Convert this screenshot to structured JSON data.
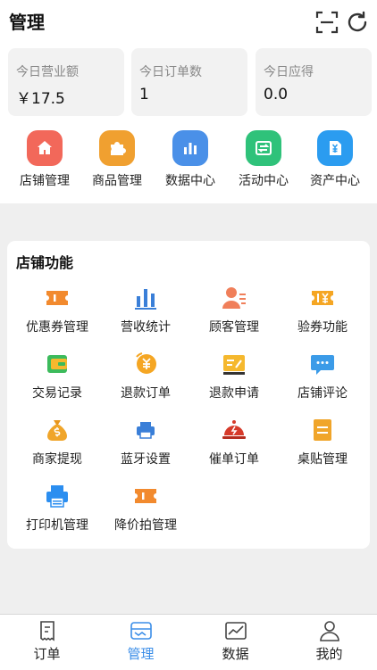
{
  "header": {
    "title": "管理",
    "scan_icon": "scan-icon",
    "refresh_icon": "refresh-icon"
  },
  "stats": [
    {
      "label": "今日营业额",
      "value": "￥17.5"
    },
    {
      "label": "今日订单数",
      "value": "1"
    },
    {
      "label": "今日应得",
      "value": "0.0"
    }
  ],
  "quick_menu": [
    {
      "label": "店铺管理",
      "icon": "store-icon",
      "color": "#f2685a"
    },
    {
      "label": "商品管理",
      "icon": "puzzle-icon",
      "color": "#f0a030"
    },
    {
      "label": "数据中心",
      "icon": "bar-chart-icon",
      "color": "#4a90e8"
    },
    {
      "label": "活动中心",
      "icon": "exchange-icon",
      "color": "#2fc27a"
    },
    {
      "label": "资产中心",
      "icon": "wallet-icon",
      "color": "#2b9cf0"
    }
  ],
  "store_functions": {
    "title": "店铺功能",
    "items": [
      {
        "label": "优惠券管理",
        "icon": "coupon-icon"
      },
      {
        "label": "营收统计",
        "icon": "stats-icon"
      },
      {
        "label": "顾客管理",
        "icon": "customer-icon"
      },
      {
        "label": "验券功能",
        "icon": "verify-coupon-icon"
      },
      {
        "label": "交易记录",
        "icon": "wallet-record-icon"
      },
      {
        "label": "退款订单",
        "icon": "refund-icon"
      },
      {
        "label": "退款申请",
        "icon": "refund-apply-icon"
      },
      {
        "label": "店铺评论",
        "icon": "comment-icon"
      },
      {
        "label": "商家提现",
        "icon": "money-bag-icon"
      },
      {
        "label": "蓝牙设置",
        "icon": "bluetooth-printer-icon"
      },
      {
        "label": "催单订单",
        "icon": "bell-icon"
      },
      {
        "label": "桌贴管理",
        "icon": "sticker-icon"
      },
      {
        "label": "打印机管理",
        "icon": "printer-icon"
      },
      {
        "label": "降价拍管理",
        "icon": "price-cut-icon"
      }
    ]
  },
  "tabbar": {
    "active": "管理",
    "active_color": "#3b8ee8",
    "items": [
      {
        "label": "订单",
        "icon": "order-icon"
      },
      {
        "label": "管理",
        "icon": "manage-icon"
      },
      {
        "label": "数据",
        "icon": "data-icon"
      },
      {
        "label": "我的",
        "icon": "user-icon"
      }
    ]
  }
}
